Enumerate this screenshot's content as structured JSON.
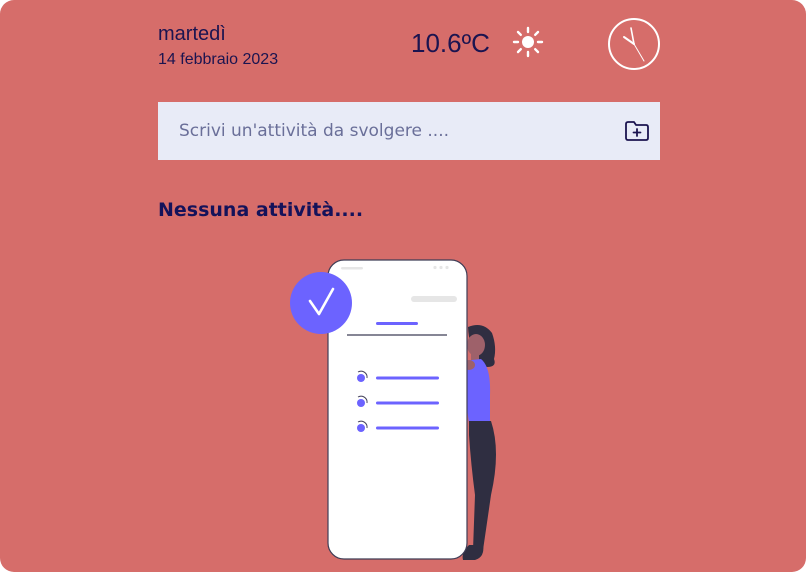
{
  "header": {
    "day": "martedì",
    "date": "14 febbraio 2023",
    "temperature": "10.6ºC",
    "weather_icon": "sun-icon",
    "clock_icon": "clock-icon"
  },
  "task_input": {
    "placeholder": "Scrivi un'attività da svolgere ....",
    "value": "",
    "add_icon": "folder-plus-icon"
  },
  "empty_state": {
    "message": "Nessuna attività....",
    "illustration": "woman-with-phone-checklist-illustration"
  },
  "colors": {
    "background": "#d66d6a",
    "text_dark": "#1b1450",
    "input_bg": "#e8ebf7",
    "accent": "#6c63ff"
  }
}
